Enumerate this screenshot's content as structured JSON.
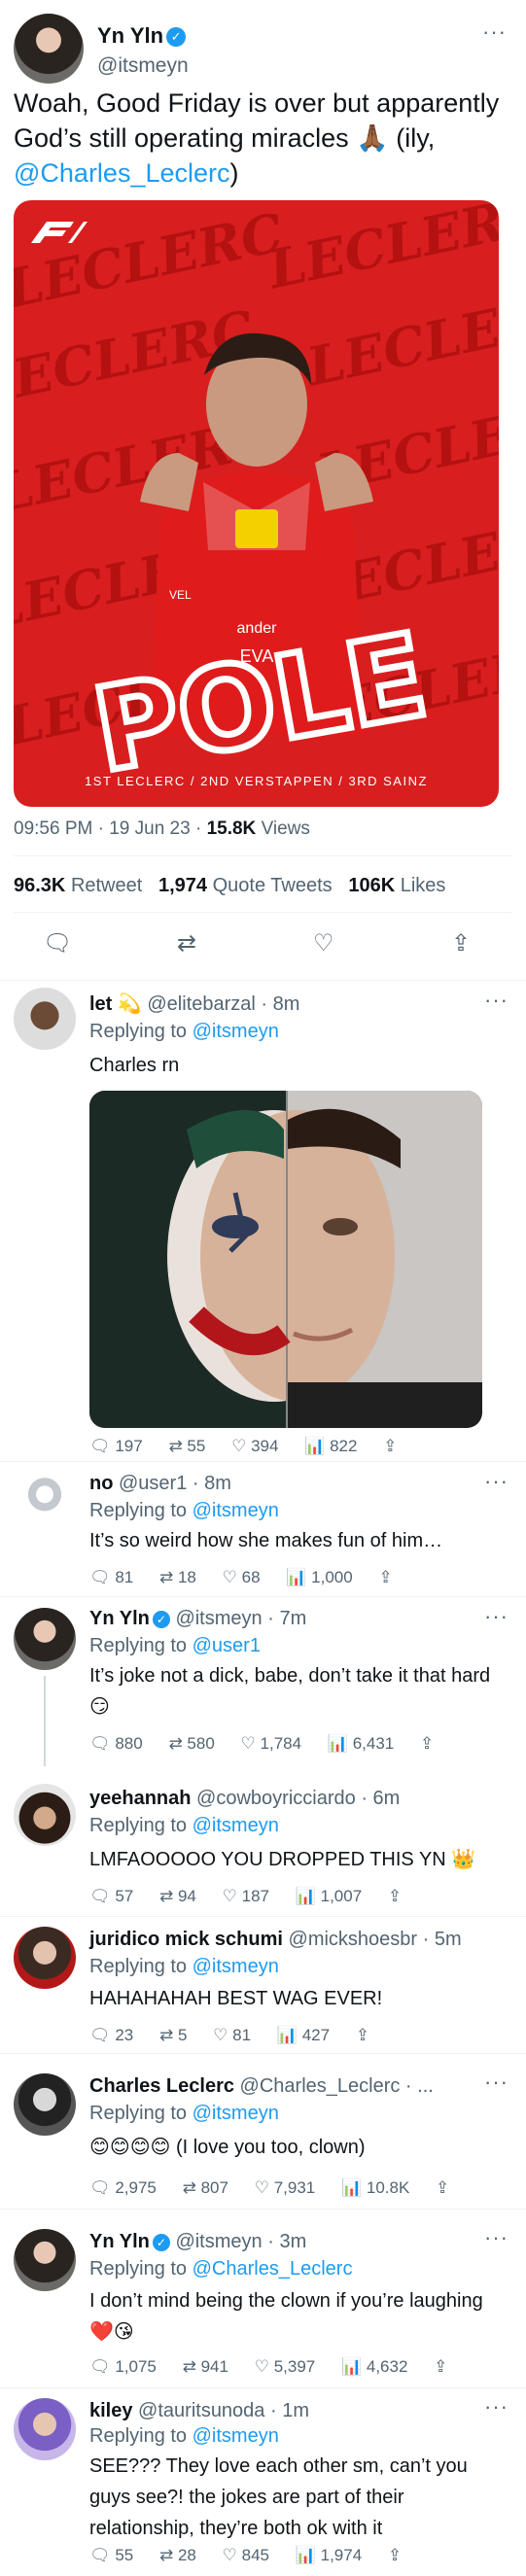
{
  "main_tweet": {
    "author_name": "Yn Yln",
    "handle": "@itsmeyn",
    "text_part1": "Woah, Good Friday is over but apparently God’s still operating miracles 🙏🏾 (ily, ",
    "text_mention": "@Charles_Leclerc",
    "text_part2": ")",
    "image": {
      "background_words": "LECLERC",
      "overlay_word": "POLE",
      "caption": "1ST LECLERC / 2ND VERSTAPPEN / 3RD SAINZ",
      "brand_text": "ander",
      "brand_text2": "EVA",
      "helmet_text": "VEL"
    },
    "time": "09:56 PM",
    "date": "19 Jun 23",
    "views_value": "15.8K",
    "views_label": "Views",
    "retweets_value": "96.3K",
    "retweets_label": "Retweet",
    "quotes_value": "1,974",
    "quotes_label": "Quote Tweets",
    "likes_value": "106K",
    "likes_label": "Likes",
    "icons": [
      "reply-icon",
      "retweet-icon",
      "like-icon",
      "share-icon"
    ]
  },
  "replies": [
    {
      "name": "let 💫",
      "handle": "@elitebarzal",
      "time": "8m",
      "replying_label": "Replying to",
      "replying_to": "@itsmeyn",
      "text": "Charles rn",
      "stats": {
        "replies": "197",
        "retweets": "55",
        "likes": "394",
        "views": "822"
      }
    },
    {
      "name": "no",
      "handle": "@user1",
      "time": "8m",
      "replying_label": "Replying to",
      "replying_to": "@itsmeyn",
      "text": "It’s so weird how she makes fun of him…",
      "stats": {
        "replies": "81",
        "retweets": "18",
        "likes": "68",
        "views": "1,000"
      }
    },
    {
      "name": "Yn Yln",
      "handle": "@itsmeyn",
      "time": "7m",
      "replying_label": "Replying to",
      "replying_to": "@user1",
      "text": "It’s joke not a dick, babe, don’t take it that hard 😏",
      "stats": {
        "replies": "880",
        "retweets": "580",
        "likes": "1,784",
        "views": "6,431"
      }
    },
    {
      "name": "yeehannah",
      "handle": "@cowboyricciardo",
      "time": "6m",
      "replying_label": "Replying to",
      "replying_to": "@itsmeyn",
      "text": "LMFAOOOOO YOU DROPPED THIS YN 👑",
      "stats": {
        "replies": "57",
        "retweets": "94",
        "likes": "187",
        "views": "1,007"
      }
    },
    {
      "name": "juridico mick schumi",
      "handle": "@mickshoesbr",
      "time": "5m",
      "replying_label": "Replying to",
      "replying_to": "@itsmeyn",
      "text": "HAHAHAHAH BEST WAG EVER!",
      "stats": {
        "replies": "23",
        "retweets": "5",
        "likes": "81",
        "views": "427"
      }
    },
    {
      "name": "Charles Leclerc",
      "handle": "@Charles_Leclerc · ...",
      "time": "",
      "replying_label": "Replying to",
      "replying_to": "@itsmeyn",
      "text": "😊😊😊😊 (I love you too, clown)",
      "stats": {
        "replies": "2,975",
        "retweets": "807",
        "likes": "7,931",
        "views": "10.8K"
      }
    },
    {
      "name": "Yn Yln",
      "handle": "@itsmeyn",
      "time": "3m",
      "replying_label": "Replying to",
      "replying_to": "@Charles_Leclerc",
      "text": "I don’t mind being the clown if you’re laughing ❤️😘",
      "stats": {
        "replies": "1,075",
        "retweets": "941",
        "likes": "5,397",
        "views": "4,632"
      }
    },
    {
      "name": "kiley",
      "handle": "@tauritsunoda",
      "time": "1m",
      "replying_label": "Replying to",
      "replying_to": "@itsmeyn",
      "text": "SEE??? They love each other sm, can’t you guys see?! the jokes are part of their relationship, they’re both ok with it",
      "stats": {
        "replies": "55",
        "retweets": "28",
        "likes": "845",
        "views": "1,974"
      }
    }
  ],
  "colors": {
    "accent": "#1d9bf0",
    "muted": "#536471",
    "ferrari_red": "#d81e1e"
  }
}
